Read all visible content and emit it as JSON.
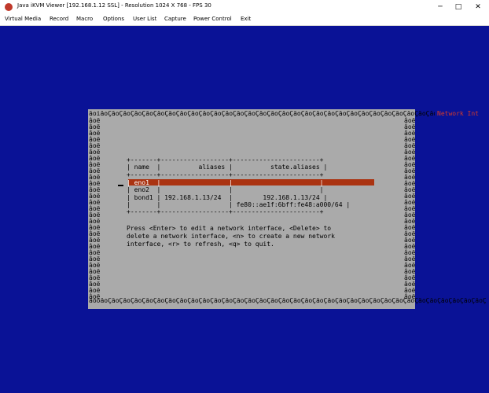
{
  "window": {
    "title": "Java iKVM Viewer  [192.168.1.12 SSL]  - Resolution 1024 X 768 - FPS 30",
    "minimize": "─",
    "maximize": "□",
    "close": "✕"
  },
  "menu": [
    "Virtual Media",
    "Record",
    "Macro",
    "Options",
    "User List",
    "Capture",
    "Power Control",
    "Exit"
  ],
  "terminal": {
    "top_border": "âoiâoÇâoÇâoÇâoÇâoÇâoÇâoÇâoÇâoÇâoÇâoÇâoÇâoÇâoÇâoÇâoÇâoÇâoÇâoÇâoÇâoÇâoÇâoÇâoÇâoÇâoÇâoÇâoÇâoÇâoÇâoÇâoÇâoÇâoÇâoÇâoÇâoÇâoÇâoÇâoÇâoÇâoÇ",
    "top_right_fragment": "Network Int",
    "side_glyph": "âoë",
    "bottom_border": "âoöâoÇâoÇâoÇâoÇâoÇâoÇâoÇâoÇâoÇâoÇâoÇâoÇâoÇâoÇâoÇâoÇâoÇâoÇâoÇâoÇâoÇâoÇâoÇâoÇâoÇâoÇâoÇâoÇâoÇâoÇâoÇâoÇâoÇâoÇâoÇâoÇâoÇâoÇâoÇâoÇâoÇâoÇâoÇâoÇâoÇâoÇâoÇâoÇâoÇâoÇ",
    "table_lines": [
      "+-------+------------------+-----------------------+",
      "| name  |          aliases |          state.aliases |",
      "+-------+------------------+-----------------------+",
      "| eno1  |                  |                       |",
      "| eno2  |                  |                       |",
      "| bond1 | 192.168.1.13/24  |        192.168.1.13/24 |",
      "|       |                  | fe80::ae1f:6bff:fe48:a000/64 |",
      "+-------+------------------+-----------------------+"
    ],
    "help_lines": [
      "Press <Enter> to edit a network interface, <Delete> to",
      "delete a network interface, <n> to create a new network",
      "interface, <r> to refresh, <q> to quit."
    ]
  },
  "colors": {
    "screen_bg": "#0a1296",
    "dialog_bg": "#aaaaaa",
    "selection": "#aa3311",
    "accent_red": "#d43a2a"
  }
}
